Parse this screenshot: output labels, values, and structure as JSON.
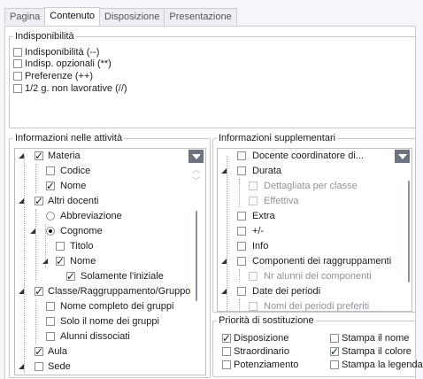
{
  "tabs": [
    "Pagina",
    "Contenuto",
    "Disposizione",
    "Presentazione"
  ],
  "active_tab": "Contenuto",
  "indisp": {
    "title": "Indisponibilità",
    "items": [
      {
        "label": "Indisponibilità (--)",
        "checked": false
      },
      {
        "label": "Indisp. opzionali (**)",
        "checked": false
      },
      {
        "label": "Preferenze (++)",
        "checked": false
      },
      {
        "label": "1/2 g. non lavorative (//)",
        "checked": false
      }
    ]
  },
  "info_attivita": {
    "title": "Informazioni nelle attività",
    "items": [
      {
        "label": "Materia",
        "control": "checkbox",
        "checked": true
      },
      {
        "label": "Codice",
        "control": "checkbox",
        "checked": false
      },
      {
        "label": "Nome",
        "control": "checkbox",
        "checked": true
      },
      {
        "label": "Altri docenti",
        "control": "checkbox",
        "checked": true
      },
      {
        "label": "Abbreviazione",
        "control": "radio",
        "checked": false
      },
      {
        "label": "Cognome",
        "control": "radio",
        "checked": true
      },
      {
        "label": "Titolo",
        "control": "checkbox",
        "checked": false
      },
      {
        "label": "Nome",
        "control": "checkbox",
        "checked": true
      },
      {
        "label": "Solamente l'iniziale",
        "control": "checkbox",
        "checked": true
      },
      {
        "label": "Classe/Raggruppamento/Gruppo",
        "control": "checkbox",
        "checked": true
      },
      {
        "label": "Nome completo dei gruppi",
        "control": "checkbox",
        "checked": false
      },
      {
        "label": "Solo il nome dei gruppi",
        "control": "checkbox",
        "checked": false
      },
      {
        "label": "Alunni dissociati",
        "control": "checkbox",
        "checked": false
      },
      {
        "label": "Aula",
        "control": "checkbox",
        "checked": true
      },
      {
        "label": "Sede",
        "control": "checkbox",
        "checked": false
      }
    ]
  },
  "info_supplementari": {
    "title": "Informazioni supplementari",
    "items": [
      {
        "label": "Docente coordinatore di...",
        "checked": false,
        "disabled": false
      },
      {
        "label": "Durata",
        "checked": false,
        "disabled": false
      },
      {
        "label": "Dettagliata per classe",
        "checked": false,
        "disabled": true
      },
      {
        "label": "Effettiva",
        "checked": false,
        "disabled": true
      },
      {
        "label": "Extra",
        "checked": false,
        "disabled": false
      },
      {
        "label": "+/-",
        "checked": false,
        "disabled": false
      },
      {
        "label": "Info",
        "checked": false,
        "disabled": false
      },
      {
        "label": "Componenti dei raggruppamenti",
        "checked": false,
        "disabled": false
      },
      {
        "label": "Nr alunni dei componenti",
        "checked": false,
        "disabled": true
      },
      {
        "label": "Date dei periodi",
        "checked": false,
        "disabled": false
      },
      {
        "label": "Nomi dei periodi preferiti",
        "checked": false,
        "disabled": true
      }
    ]
  },
  "priorita": {
    "title": "Priorità di sostituzione",
    "items": [
      {
        "label": "Disposizione",
        "checked": true
      },
      {
        "label": "Stampa il nome",
        "checked": false
      },
      {
        "label": "Straordinario",
        "checked": false
      },
      {
        "label": "Stampa il colore",
        "checked": true
      },
      {
        "label": "Potenziamento",
        "checked": false
      },
      {
        "label": "Stampa la legenda",
        "checked": false
      }
    ]
  }
}
